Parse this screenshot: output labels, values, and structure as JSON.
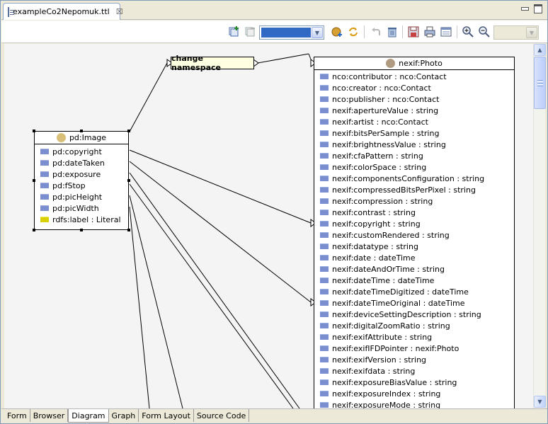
{
  "editor": {
    "tab_title": "exampleCo2Nepomuk.ttl",
    "tab_close": "☒"
  },
  "toolbar": {
    "buttons": [
      "add-icon",
      "remove-icon",
      "import-icon",
      "refresh-icon",
      "undo-icon",
      "delete-icon",
      "save-icon",
      "print-icon",
      "layout-icon",
      "zoom-in-icon",
      "zoom-out-icon"
    ]
  },
  "diagram": {
    "transform_label": "change namespace",
    "source": {
      "title": "pd:Image",
      "color": "#d8c07a",
      "properties": [
        {
          "label": "pd:copyright",
          "kind": "object"
        },
        {
          "label": "pd:dateTaken",
          "kind": "object"
        },
        {
          "label": "pd:exposure",
          "kind": "object"
        },
        {
          "label": "pd:fStop",
          "kind": "object"
        },
        {
          "label": "pd:picHeight",
          "kind": "object"
        },
        {
          "label": "pd:picWidth",
          "kind": "object"
        },
        {
          "label": "rdfs:label : Literal",
          "kind": "literal"
        }
      ]
    },
    "target": {
      "title": "nexif:Photo",
      "color": "#b09a80",
      "properties": [
        "nco:contributor : nco:Contact",
        "nco:creator : nco:Contact",
        "nco:publisher : nco:Contact",
        "nexif:apertureValue : string",
        "nexif:artist : nco:Contact",
        "nexif:bitsPerSample : string",
        "nexif:brightnessValue : string",
        "nexif:cfaPattern : string",
        "nexif:colorSpace : string",
        "nexif:componentsConfiguration : string",
        "nexif:compressedBitsPerPixel : string",
        "nexif:compression : string",
        "nexif:contrast : string",
        "nexif:copyright : string",
        "nexif:customRendered : string",
        "nexif:datatype : string",
        "nexif:date : dateTime",
        "nexif:dateAndOrTime : string",
        "nexif:dateTime : dateTime",
        "nexif:dateTimeDigitized : dateTime",
        "nexif:dateTimeOriginal : dateTime",
        "nexif:deviceSettingDescription : string",
        "nexif:digitalZoomRatio : string",
        "nexif:exifAttribute : string",
        "nexif:exifIFDPointer : nexif:Photo",
        "nexif:exifVersion : string",
        "nexif:exifdata : string",
        "nexif:exposureBiasValue : string",
        "nexif:exposureIndex : string",
        "nexif:exposureMode : string"
      ]
    }
  },
  "bottom_tabs": [
    "Form",
    "Browser",
    "Diagram",
    "Graph",
    "Form Layout",
    "Source Code"
  ],
  "active_bottom_tab": "Diagram"
}
